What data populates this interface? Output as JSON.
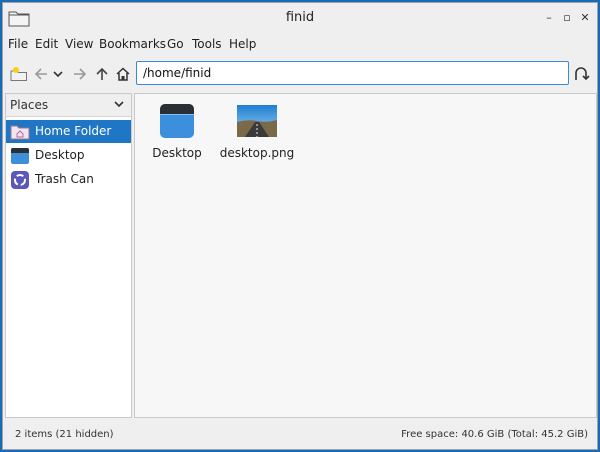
{
  "window": {
    "title": "finid"
  },
  "window_controls": {
    "minimize": "–",
    "maximize": "▫",
    "close": "✕"
  },
  "menubar": [
    "File",
    "Edit",
    "View",
    "Bookmarks",
    "Go",
    "Tools",
    "Help"
  ],
  "toolbar": {
    "path_value": "/home/finid",
    "icons": [
      "new-folder-icon",
      "back-icon",
      "history-dropdown-icon",
      "forward-icon",
      "up-icon",
      "home-icon",
      "go-icon"
    ]
  },
  "sidebar": {
    "header": "Places",
    "items": [
      {
        "label": "Home Folder",
        "icon": "home-folder-icon",
        "selected": true
      },
      {
        "label": "Desktop",
        "icon": "desktop-icon",
        "selected": false
      },
      {
        "label": "Trash Can",
        "icon": "trash-icon",
        "selected": false
      }
    ]
  },
  "files": [
    {
      "name": "Desktop",
      "icon": "folder-icon"
    },
    {
      "name": "desktop.png",
      "icon": "image-thumbnail"
    }
  ],
  "status": {
    "left": "2 items (21 hidden)",
    "right": "Free space: 40.6 GiB (Total: 45.2 GiB)"
  },
  "colors": {
    "accent": "#1f76c4",
    "desktop_bg": "#1a6bb5"
  }
}
